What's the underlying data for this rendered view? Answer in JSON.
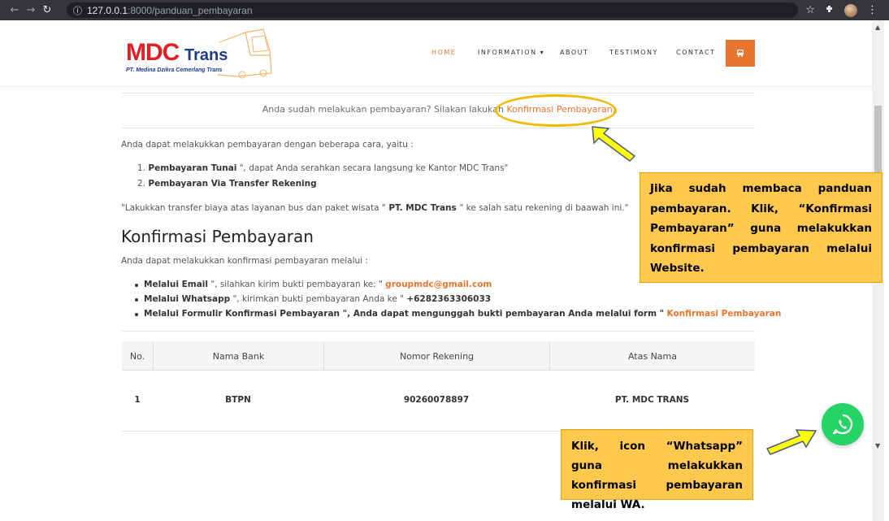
{
  "browser": {
    "url_host": "127.0.0.1",
    "url_path": ":8000/panduan_pembayaran"
  },
  "logo": {
    "brand": "MDC",
    "brand2": "Trans",
    "subtitle": "PT. Medina Dzikra Cemerlang Trans"
  },
  "nav": {
    "items": [
      "HOME",
      "INFORMATION",
      "ABOUT",
      "TESTIMONY",
      "CONTACT"
    ],
    "active": "HOME",
    "accent": "#e8752d"
  },
  "content": {
    "confirm_prefix": "Anda sudah melakukan pembayaran? Silakan lakukan",
    "confirm_link": "Konfirmasi Pembayaran.",
    "intro": "Anda dapat melakukkan pembayaran dengan beberapa cara, yaitu :",
    "methods": [
      {
        "num": "1.",
        "bold": "Pembayaran Tunai",
        "rest": " \", dapat Anda serahkan secara langsung ke Kantor MDC Trans\""
      },
      {
        "num": "2.",
        "bold": "Pembayaran Via Transfer Rekening",
        "rest": ""
      }
    ],
    "transfer_prefix": "\"Lakukkan transfer biaya atas layanan bus dan paket wisata \"",
    "transfer_bold": " PT. MDC Trans ",
    "transfer_suffix": "\" ke salah satu rekening di baawah ini.\"",
    "heading": "Konfirmasi Pembayaran",
    "confirm_intro": "Anda dapat melakukkan konfirmasi pembayaran melalui :",
    "confirm_methods": [
      {
        "bold": "Melalui Email",
        "rest": " \", silahkan kirim bukti pembayaran ke: \" ",
        "value": "groupmdc@gmail.com"
      },
      {
        "bold": "Melalui Whatsapp",
        "rest": " \", kirimkan bukti pembayaran Anda ke \" ",
        "value": "+6282363306033"
      },
      {
        "bold": "Melalui Formulir Konfirmasi Pembayaran \", Anda dapat mengunggah bukti pembayaran Anda melalui form \"",
        "rest": " ",
        "value": "Konfirmasi Pembayaran"
      }
    ]
  },
  "table": {
    "headers": [
      "No.",
      "Nama Bank",
      "Nomor Rekening",
      "Atas Nama"
    ],
    "rows": [
      [
        "1",
        "BTPN",
        "90260078897",
        "PT. MDC TRANS"
      ]
    ]
  },
  "callouts": {
    "c1": "Jika sudah membaca panduan pembayaran. Klik, “Konfirmasi Pembayaran” guna melakukkan konfirmasi pembayaran melalui Website.",
    "c2": "Klik, icon “Whatsapp” guna melakukkan konfirmasi pembayaran melalui WA."
  },
  "icons": [
    "back-icon",
    "forward-icon",
    "reload-icon",
    "info-icon",
    "star-icon",
    "extensions-icon",
    "bus-icon",
    "whatsapp-icon"
  ]
}
